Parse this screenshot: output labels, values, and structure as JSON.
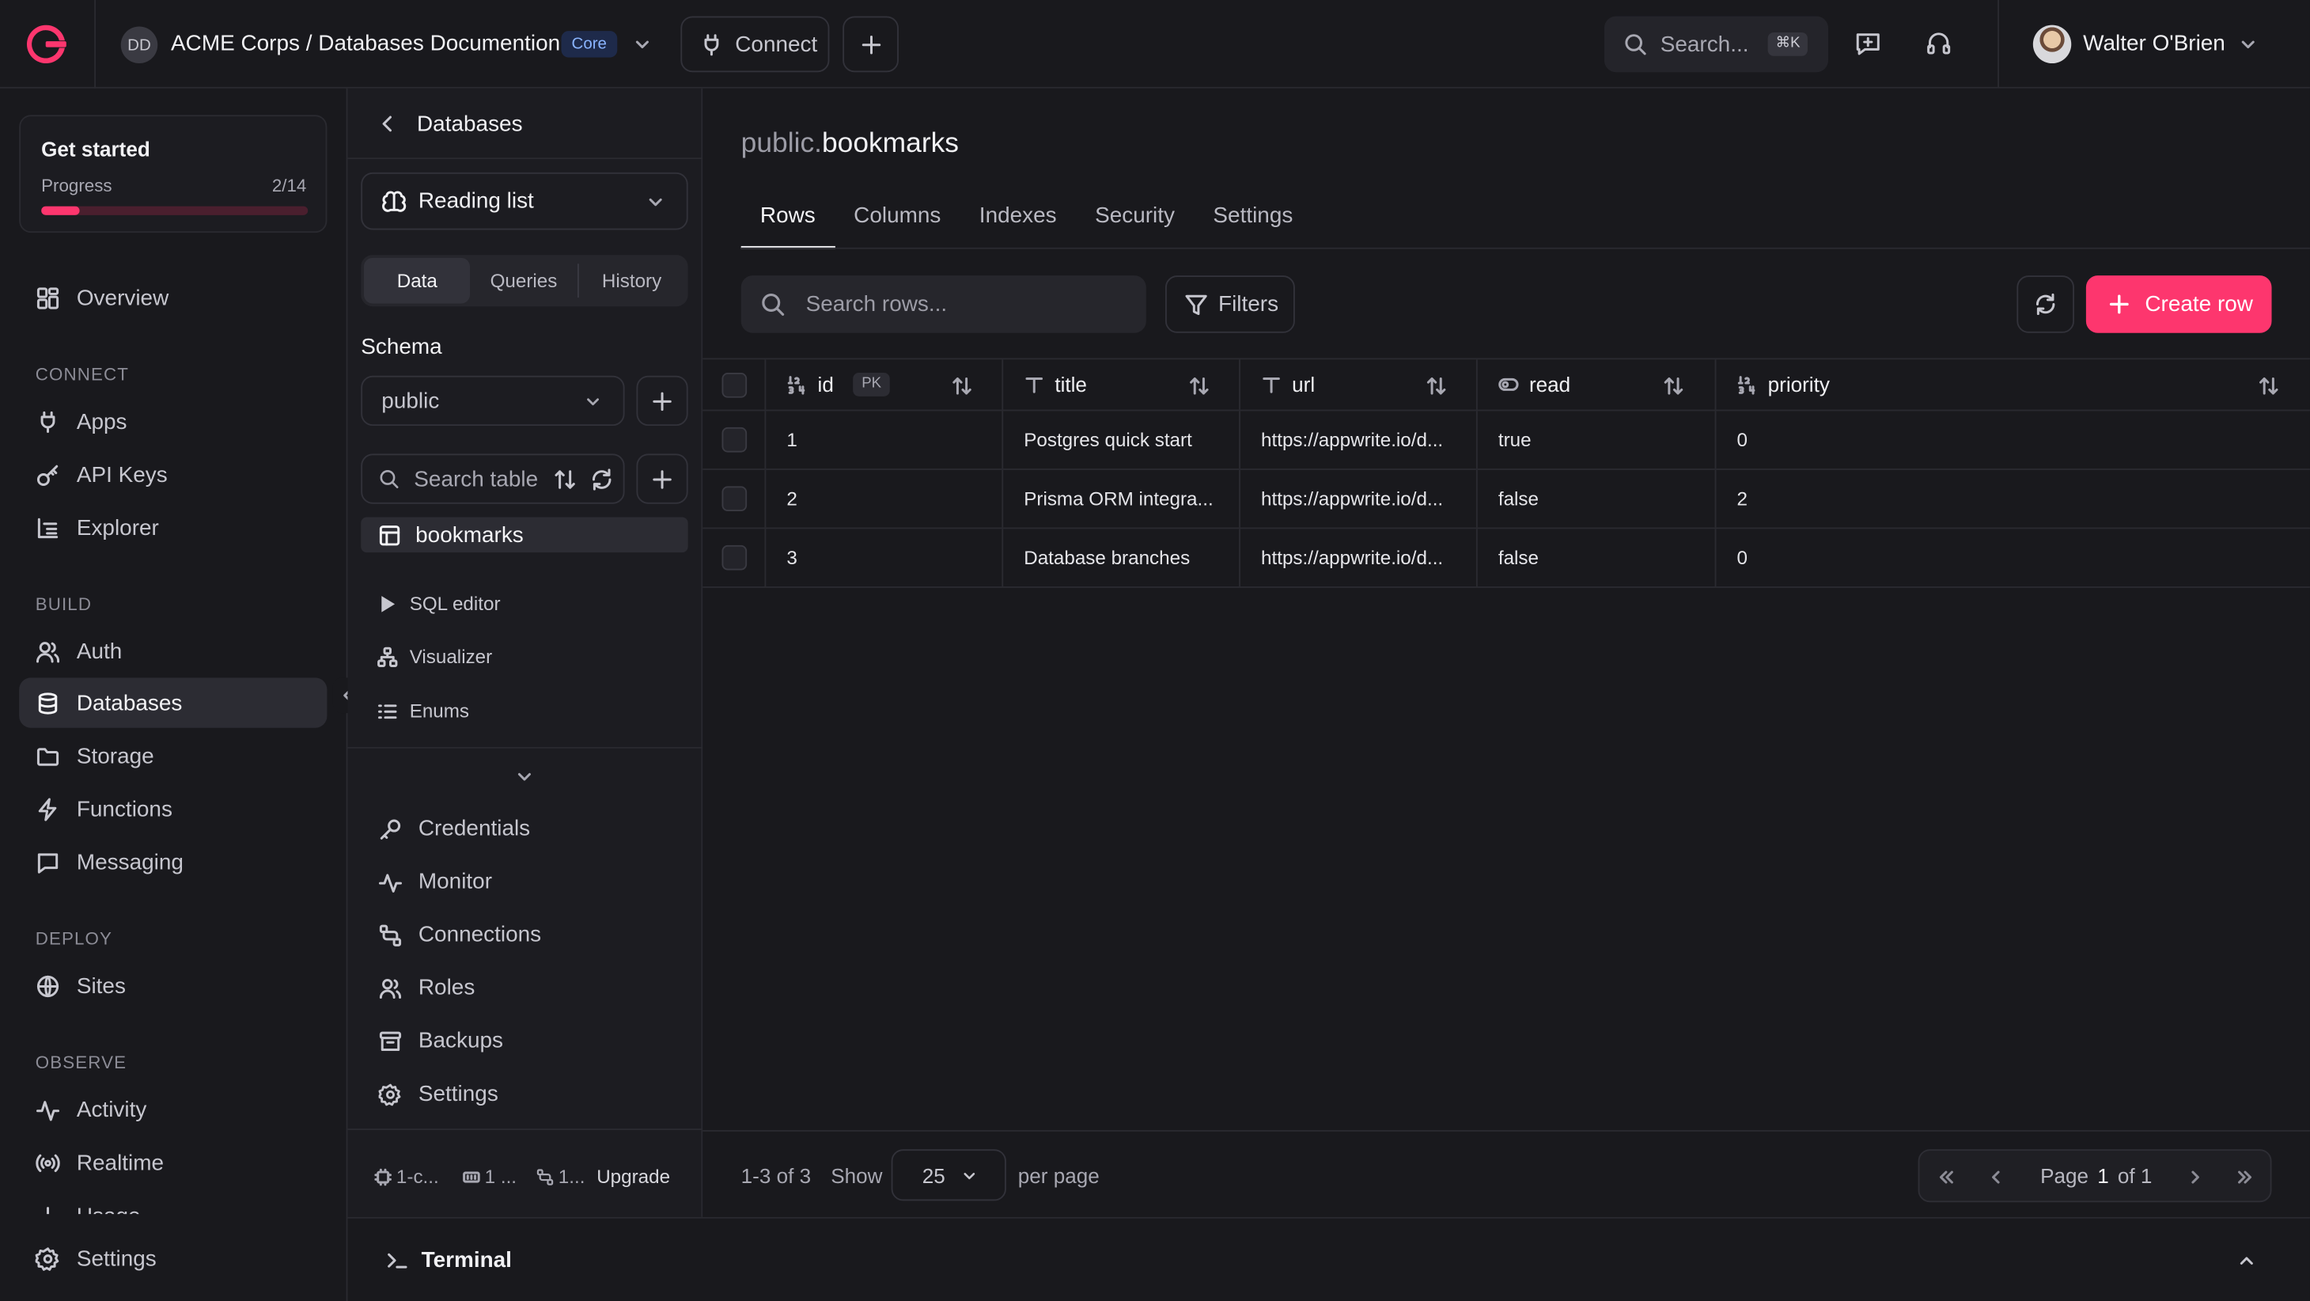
{
  "topbar": {
    "org_initials": "DD",
    "project_name": "ACME Corps / Databases Documention",
    "plan_badge": "Core",
    "connect_label": "Connect",
    "search_placeholder": "Search...",
    "search_shortcut": "⌘K",
    "user_name": "Walter O'Brien"
  },
  "sidebar": {
    "get_started": {
      "title": "Get started",
      "progress_label": "Progress",
      "progress_value": "2/14",
      "progress_fraction": 0.1429
    },
    "overview": "Overview",
    "sections": {
      "connect": "CONNECT",
      "build": "BUILD",
      "deploy": "DEPLOY",
      "observe": "OBSERVE"
    },
    "connect_items": [
      "Apps",
      "API Keys",
      "Explorer"
    ],
    "build_items": [
      "Auth",
      "Databases",
      "Storage",
      "Functions",
      "Messaging"
    ],
    "deploy_items": [
      "Sites"
    ],
    "observe_items": [
      "Activity",
      "Realtime",
      "Usage"
    ],
    "settings": "Settings"
  },
  "dbpanel": {
    "title": "Databases",
    "database_select": "Reading list",
    "segments": [
      "Data",
      "Queries",
      "History"
    ],
    "schema_label": "Schema",
    "schema_value": "public",
    "table_search_placeholder": "Search table",
    "tables": [
      "bookmarks"
    ],
    "tools": [
      "SQL editor",
      "Visualizer",
      "Enums"
    ],
    "nav": [
      "Credentials",
      "Monitor",
      "Connections",
      "Roles",
      "Backups",
      "Settings"
    ],
    "footer": {
      "cpu": "1-c...",
      "memory": "1 ...",
      "connections": "1...",
      "upgrade": "Upgrade"
    }
  },
  "main": {
    "breadcrumb_schema": "public.",
    "breadcrumb_table": "bookmarks",
    "tabs": [
      "Rows",
      "Columns",
      "Indexes",
      "Security",
      "Settings"
    ],
    "row_search_placeholder": "Search rows...",
    "filters_label": "Filters",
    "create_row_label": "Create row",
    "columns": [
      {
        "name": "id",
        "type_icon": "integer-icon",
        "pk": "PK"
      },
      {
        "name": "title",
        "type_icon": "text-icon"
      },
      {
        "name": "url",
        "type_icon": "text-icon"
      },
      {
        "name": "read",
        "type_icon": "boolean-icon"
      },
      {
        "name": "priority",
        "type_icon": "integer-icon"
      }
    ],
    "rows": [
      {
        "id": "1",
        "title": "Postgres quick start",
        "url": "https://appwrite.io/d...",
        "read": "true",
        "priority": "0"
      },
      {
        "id": "2",
        "title": "Prisma ORM integra...",
        "url": "https://appwrite.io/d...",
        "read": "false",
        "priority": "2"
      },
      {
        "id": "3",
        "title": "Database branches",
        "url": "https://appwrite.io/d...",
        "read": "false",
        "priority": "0"
      }
    ],
    "footer": {
      "range": "1-3 of 3",
      "show_label": "Show",
      "per_page_value": "25",
      "per_page_label": "per page",
      "page_label": "Page",
      "page_current": "1",
      "page_total": "of 1"
    }
  },
  "terminal": {
    "label": "Terminal"
  },
  "colors": {
    "accent": "#fd366e",
    "background": "#19191d",
    "panel": "#1c1c21",
    "border": "#2a2a30"
  }
}
